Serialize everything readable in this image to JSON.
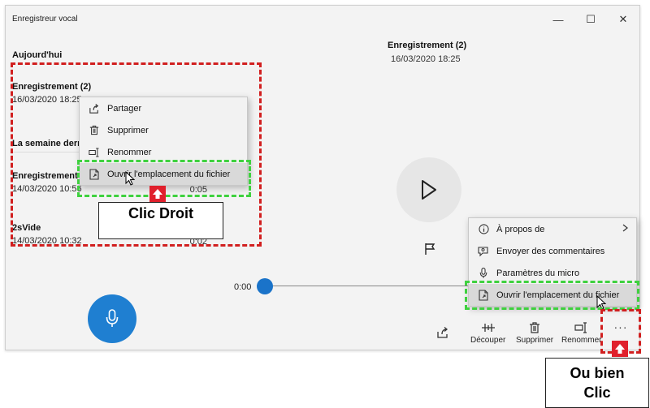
{
  "window": {
    "title": "Enregistreur vocal",
    "controls": {
      "minimize": "—",
      "maximize": "☐",
      "close": "✕"
    }
  },
  "list": {
    "today_header": "Aujourd'hui",
    "week_header": "La semaine dernière",
    "recordings": [
      {
        "name": "Enregistrement (2)",
        "date": "16/03/2020 18:25",
        "duration": ""
      },
      {
        "name": "Enregistrement",
        "date": "14/03/2020 10:56",
        "duration": "0:05"
      },
      {
        "name": "2sVide",
        "date": "14/03/2020 10:32",
        "duration": "0:02"
      }
    ]
  },
  "detail": {
    "title": "Enregistrement (2)",
    "date": "16/03/2020 18:25",
    "time_start": "0:00",
    "progress": 0
  },
  "context_menu": {
    "items": [
      {
        "label": "Partager",
        "icon": "share-icon"
      },
      {
        "label": "Supprimer",
        "icon": "trash-icon"
      },
      {
        "label": "Renommer",
        "icon": "rename-icon"
      },
      {
        "label": "Ouvrir l'emplacement du fichier",
        "icon": "open-file-location-icon"
      }
    ]
  },
  "more_menu": {
    "items": [
      {
        "label": "À propos de",
        "icon": "info-icon"
      },
      {
        "label": "Envoyer des commentaires",
        "icon": "feedback-icon"
      },
      {
        "label": "Paramètres du micro",
        "icon": "mic-settings-icon"
      },
      {
        "label": "Ouvrir l'emplacement du fichier",
        "icon": "open-file-location-icon"
      }
    ]
  },
  "toolbar": {
    "trim_label": "Découper",
    "delete_label": "Supprimer",
    "rename_label": "Renommer",
    "more_label": "···"
  },
  "annotations": {
    "right_click_label": "Clic Droit",
    "or_click_label_line1": "Ou bien",
    "or_click_label_line2": "Clic",
    "red_color": "#d11f1f",
    "green_color": "#3fd13f"
  },
  "colors": {
    "accent": "#1f7fd1",
    "thumb": "#1a73c9",
    "background": "#f3f3f3"
  }
}
